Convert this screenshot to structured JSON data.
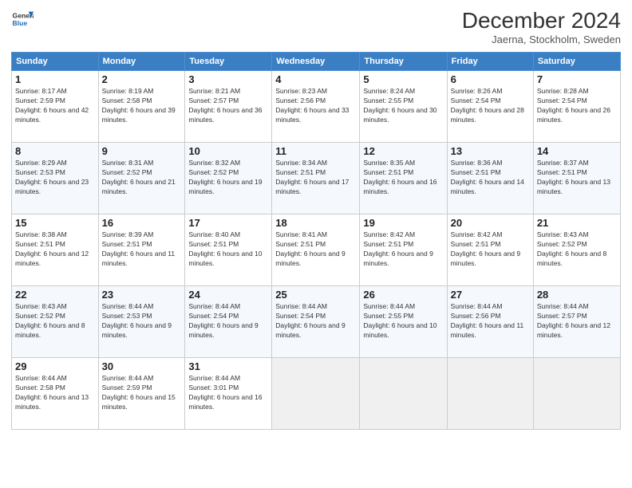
{
  "logo": {
    "line1": "General",
    "line2": "Blue"
  },
  "title": "December 2024",
  "subtitle": "Jaerna, Stockholm, Sweden",
  "days_header": [
    "Sunday",
    "Monday",
    "Tuesday",
    "Wednesday",
    "Thursday",
    "Friday",
    "Saturday"
  ],
  "weeks": [
    [
      {
        "day": "1",
        "sunrise": "8:17 AM",
        "sunset": "2:59 PM",
        "daylight": "6 hours and 42 minutes."
      },
      {
        "day": "2",
        "sunrise": "8:19 AM",
        "sunset": "2:58 PM",
        "daylight": "6 hours and 39 minutes."
      },
      {
        "day": "3",
        "sunrise": "8:21 AM",
        "sunset": "2:57 PM",
        "daylight": "6 hours and 36 minutes."
      },
      {
        "day": "4",
        "sunrise": "8:23 AM",
        "sunset": "2:56 PM",
        "daylight": "6 hours and 33 minutes."
      },
      {
        "day": "5",
        "sunrise": "8:24 AM",
        "sunset": "2:55 PM",
        "daylight": "6 hours and 30 minutes."
      },
      {
        "day": "6",
        "sunrise": "8:26 AM",
        "sunset": "2:54 PM",
        "daylight": "6 hours and 28 minutes."
      },
      {
        "day": "7",
        "sunrise": "8:28 AM",
        "sunset": "2:54 PM",
        "daylight": "6 hours and 26 minutes."
      }
    ],
    [
      {
        "day": "8",
        "sunrise": "8:29 AM",
        "sunset": "2:53 PM",
        "daylight": "6 hours and 23 minutes."
      },
      {
        "day": "9",
        "sunrise": "8:31 AM",
        "sunset": "2:52 PM",
        "daylight": "6 hours and 21 minutes."
      },
      {
        "day": "10",
        "sunrise": "8:32 AM",
        "sunset": "2:52 PM",
        "daylight": "6 hours and 19 minutes."
      },
      {
        "day": "11",
        "sunrise": "8:34 AM",
        "sunset": "2:51 PM",
        "daylight": "6 hours and 17 minutes."
      },
      {
        "day": "12",
        "sunrise": "8:35 AM",
        "sunset": "2:51 PM",
        "daylight": "6 hours and 16 minutes."
      },
      {
        "day": "13",
        "sunrise": "8:36 AM",
        "sunset": "2:51 PM",
        "daylight": "6 hours and 14 minutes."
      },
      {
        "day": "14",
        "sunrise": "8:37 AM",
        "sunset": "2:51 PM",
        "daylight": "6 hours and 13 minutes."
      }
    ],
    [
      {
        "day": "15",
        "sunrise": "8:38 AM",
        "sunset": "2:51 PM",
        "daylight": "6 hours and 12 minutes."
      },
      {
        "day": "16",
        "sunrise": "8:39 AM",
        "sunset": "2:51 PM",
        "daylight": "6 hours and 11 minutes."
      },
      {
        "day": "17",
        "sunrise": "8:40 AM",
        "sunset": "2:51 PM",
        "daylight": "6 hours and 10 minutes."
      },
      {
        "day": "18",
        "sunrise": "8:41 AM",
        "sunset": "2:51 PM",
        "daylight": "6 hours and 9 minutes."
      },
      {
        "day": "19",
        "sunrise": "8:42 AM",
        "sunset": "2:51 PM",
        "daylight": "6 hours and 9 minutes."
      },
      {
        "day": "20",
        "sunrise": "8:42 AM",
        "sunset": "2:51 PM",
        "daylight": "6 hours and 9 minutes."
      },
      {
        "day": "21",
        "sunrise": "8:43 AM",
        "sunset": "2:52 PM",
        "daylight": "6 hours and 8 minutes."
      }
    ],
    [
      {
        "day": "22",
        "sunrise": "8:43 AM",
        "sunset": "2:52 PM",
        "daylight": "6 hours and 8 minutes."
      },
      {
        "day": "23",
        "sunrise": "8:44 AM",
        "sunset": "2:53 PM",
        "daylight": "6 hours and 9 minutes."
      },
      {
        "day": "24",
        "sunrise": "8:44 AM",
        "sunset": "2:54 PM",
        "daylight": "6 hours and 9 minutes."
      },
      {
        "day": "25",
        "sunrise": "8:44 AM",
        "sunset": "2:54 PM",
        "daylight": "6 hours and 9 minutes."
      },
      {
        "day": "26",
        "sunrise": "8:44 AM",
        "sunset": "2:55 PM",
        "daylight": "6 hours and 10 minutes."
      },
      {
        "day": "27",
        "sunrise": "8:44 AM",
        "sunset": "2:56 PM",
        "daylight": "6 hours and 11 minutes."
      },
      {
        "day": "28",
        "sunrise": "8:44 AM",
        "sunset": "2:57 PM",
        "daylight": "6 hours and 12 minutes."
      }
    ],
    [
      {
        "day": "29",
        "sunrise": "8:44 AM",
        "sunset": "2:58 PM",
        "daylight": "6 hours and 13 minutes."
      },
      {
        "day": "30",
        "sunrise": "8:44 AM",
        "sunset": "2:59 PM",
        "daylight": "6 hours and 15 minutes."
      },
      {
        "day": "31",
        "sunrise": "8:44 AM",
        "sunset": "3:01 PM",
        "daylight": "6 hours and 16 minutes."
      },
      null,
      null,
      null,
      null
    ]
  ]
}
